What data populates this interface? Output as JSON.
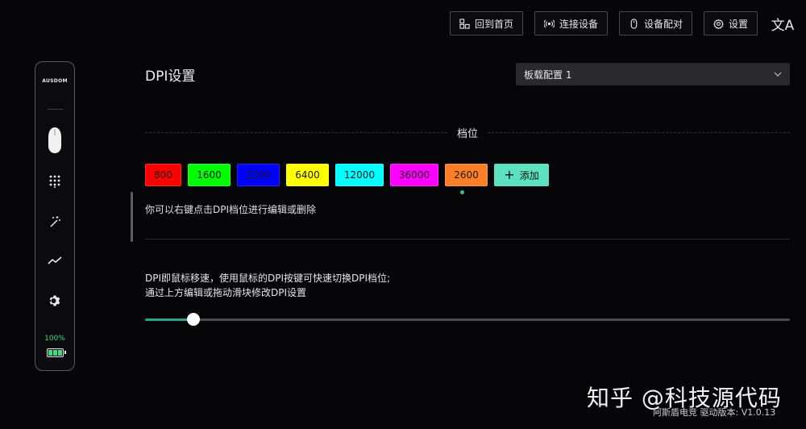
{
  "nav": {
    "home": "回到首页",
    "connect": "连接设备",
    "pair": "设备配对",
    "settings": "设置",
    "lang_icon": "文A"
  },
  "sidebar": {
    "brand": "AUSDOM",
    "items": [
      "mouse-icon",
      "keypad-grid-icon",
      "magic-wand-icon",
      "trend-line-icon",
      "gear-icon"
    ],
    "battery": "100%",
    "battery_color": "#3ddc84"
  },
  "page": {
    "title": "DPI设置",
    "profile_select": "板载配置 1",
    "section_label": "档位",
    "hint": "你可以右键点击DPI档位进行编辑或删除",
    "desc_line1": "DPI即鼠标移速，使用鼠标的DPI按键可快速切换DPI档位;",
    "desc_line2": "通过上方编辑或拖动滑块修改DPI设置",
    "add_label": "添加",
    "slider_value_fraction": 0.075
  },
  "dpi_levels": [
    {
      "value": "800",
      "color": "#ff0000"
    },
    {
      "value": "1600",
      "color": "#00ff00"
    },
    {
      "value": "3200",
      "color": "#0000ff"
    },
    {
      "value": "6400",
      "color": "#ffff00"
    },
    {
      "value": "12000",
      "color": "#00ffff"
    },
    {
      "value": "36000",
      "color": "#ff00ff"
    },
    {
      "value": "2600",
      "color": "#ff7f27"
    }
  ],
  "active_level_index": 6,
  "accent_color": "#5ce2c0",
  "watermark": "知乎 @科技源代码",
  "version": "阿斯盾电竞 驱动版本: V1.0.13"
}
